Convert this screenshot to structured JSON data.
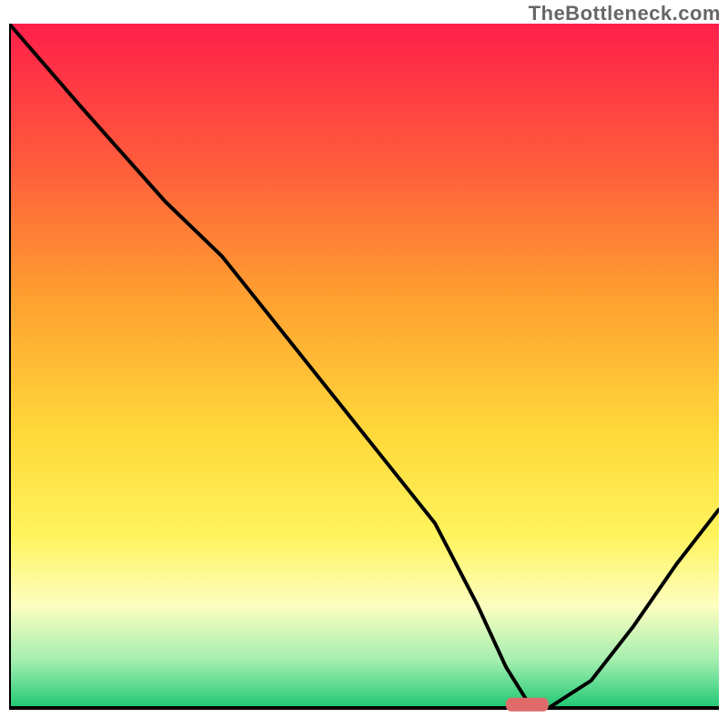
{
  "watermark": "TheBottleneck.com",
  "chart_data": {
    "type": "line",
    "title": "",
    "xlabel": "",
    "ylabel": "",
    "xlim": [
      0,
      100
    ],
    "ylim": [
      0,
      100
    ],
    "grid": false,
    "gradient_stops": [
      {
        "offset": 0.0,
        "color": "#ff1f4a"
      },
      {
        "offset": 0.2,
        "color": "#ff5a3c"
      },
      {
        "offset": 0.4,
        "color": "#ffa030"
      },
      {
        "offset": 0.6,
        "color": "#ffd93a"
      },
      {
        "offset": 0.75,
        "color": "#fff45e"
      },
      {
        "offset": 0.85,
        "color": "#fdfec0"
      },
      {
        "offset": 0.93,
        "color": "#a4efb0"
      },
      {
        "offset": 1.0,
        "color": "#1ec873"
      }
    ],
    "series": [
      {
        "name": "bottleneck-curve",
        "x": [
          0,
          10,
          22,
          30,
          40,
          50,
          60,
          66,
          70,
          73,
          76,
          82,
          88,
          94,
          100
        ],
        "y": [
          100,
          88,
          74,
          66,
          53,
          40,
          27,
          15,
          6,
          1,
          0,
          4,
          12,
          21,
          29
        ]
      }
    ],
    "marker": {
      "x": 73,
      "y": 0.5,
      "width": 6,
      "height": 2
    }
  }
}
